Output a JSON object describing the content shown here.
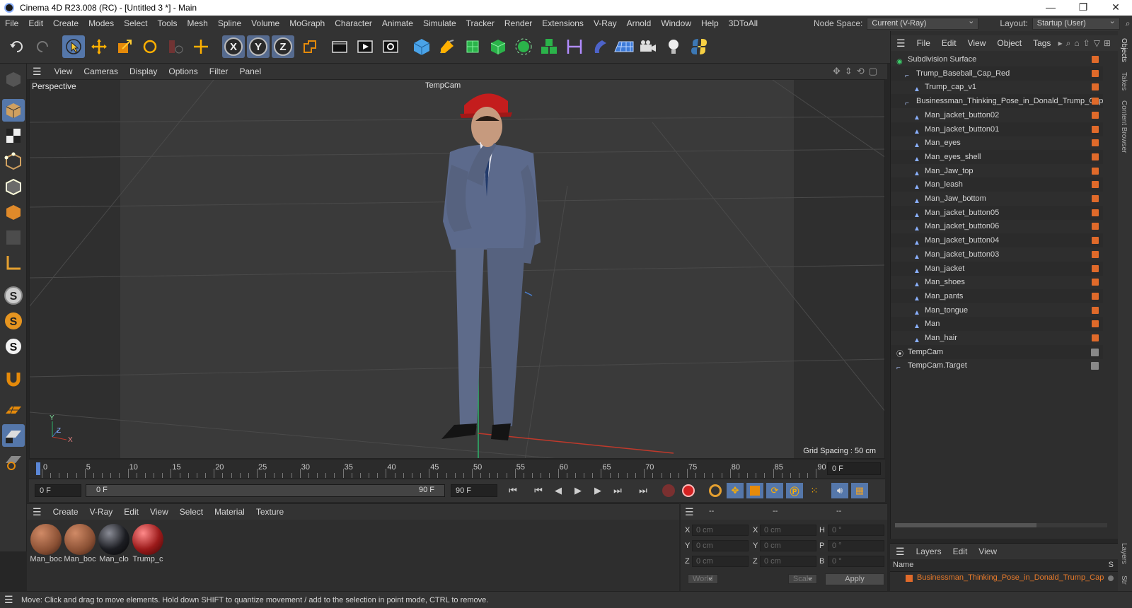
{
  "window": {
    "title": "Cinema 4D R23.008 (RC) - [Untitled 3 *] - Main",
    "controls": [
      "—",
      "❐",
      "✕"
    ]
  },
  "menubar": {
    "items": [
      "File",
      "Edit",
      "Create",
      "Modes",
      "Select",
      "Tools",
      "Mesh",
      "Spline",
      "Volume",
      "MoGraph",
      "Character",
      "Animate",
      "Simulate",
      "Tracker",
      "Render",
      "Extensions",
      "V-Ray",
      "Arnold",
      "Window",
      "Help",
      "3DToAll"
    ],
    "node_space_label": "Node Space:",
    "node_space_value": "Current (V-Ray)",
    "layout_label": "Layout:",
    "layout_value": "Startup (User)"
  },
  "toolbar": {
    "icons": [
      "undo-icon",
      "redo-icon",
      "select-arrow-icon",
      "move-icon",
      "scale-icon",
      "rotate-icon",
      "recent-tools-icon",
      "live-selection-icon",
      "x-axis-icon",
      "y-axis-icon",
      "z-axis-icon",
      "world-coordinate-icon",
      "render-region-icon",
      "render-view-icon",
      "render-settings-icon",
      "cube-icon",
      "pen-icon",
      "subdivision-icon",
      "extrude-icon",
      "mograph-cloner-icon",
      "array-icon",
      "deformer-icon",
      "floor-icon",
      "camera-icon",
      "light-icon",
      "python-icon"
    ],
    "axis_letters": [
      "X",
      "Y",
      "Z"
    ]
  },
  "viewport": {
    "menu": [
      "View",
      "Cameras",
      "Display",
      "Options",
      "Filter",
      "Panel"
    ],
    "view_name": "Perspective",
    "camera_label": "TempCam",
    "grid_spacing": "Grid Spacing : 50 cm",
    "axis": {
      "x": "X",
      "y": "Y",
      "z": "Z"
    }
  },
  "timeline": {
    "ticks": [
      "0",
      "5",
      "10",
      "15",
      "20",
      "25",
      "30",
      "35",
      "40",
      "45",
      "50",
      "55",
      "60",
      "65",
      "70",
      "75",
      "80",
      "85",
      "90"
    ],
    "current_frame": "0 F"
  },
  "transport": {
    "start_field": "0 F",
    "range_start": "0 F",
    "range_end": "90 F",
    "end_field": "90 F"
  },
  "materials": {
    "menu": [
      "Create",
      "V-Ray",
      "Edit",
      "View",
      "Select",
      "Material",
      "Texture"
    ],
    "items": [
      {
        "name": "Man_boc",
        "color": "#8a5034"
      },
      {
        "name": "Man_boc",
        "color": "#8a5034"
      },
      {
        "name": "Man_clo",
        "color": "#1c1d22"
      },
      {
        "name": "Trump_c",
        "color": "#9b1a1a"
      }
    ]
  },
  "coordinates": {
    "headers": [
      "--",
      "--",
      "--"
    ],
    "rows": [
      {
        "a": "X",
        "av": "0 cm",
        "b": "X",
        "bv": "0 cm",
        "c": "H",
        "cv": "0 °"
      },
      {
        "a": "Y",
        "av": "0 cm",
        "b": "Y",
        "bv": "0 cm",
        "c": "P",
        "cv": "0 °"
      },
      {
        "a": "Z",
        "av": "0 cm",
        "b": "Z",
        "bv": "0 cm",
        "c": "B",
        "cv": "0 °"
      }
    ],
    "mode1": "World",
    "mode2": "Scale",
    "apply": "Apply"
  },
  "objects": {
    "menu": [
      "File",
      "Edit",
      "View",
      "Object",
      "Tags"
    ],
    "tree": [
      {
        "name": "Subdivision Surface",
        "indent": 0,
        "type": "subd",
        "tag": "orange"
      },
      {
        "name": "Trump_Baseball_Cap_Red",
        "indent": 1,
        "type": "null",
        "tag": "orange"
      },
      {
        "name": "Trump_cap_v1",
        "indent": 2,
        "type": "poly",
        "tag": "orange"
      },
      {
        "name": "Businessman_Thinking_Pose_in_Donald_Trump_Cap",
        "indent": 1,
        "type": "null",
        "tag": "orange"
      },
      {
        "name": "Man_jacket_button02",
        "indent": 2,
        "type": "poly",
        "tag": "orange"
      },
      {
        "name": "Man_jacket_button01",
        "indent": 2,
        "type": "poly",
        "tag": "orange"
      },
      {
        "name": "Man_eyes",
        "indent": 2,
        "type": "poly",
        "tag": "orange"
      },
      {
        "name": "Man_eyes_shell",
        "indent": 2,
        "type": "poly",
        "tag": "orange"
      },
      {
        "name": "Man_Jaw_top",
        "indent": 2,
        "type": "poly",
        "tag": "orange"
      },
      {
        "name": "Man_leash",
        "indent": 2,
        "type": "poly",
        "tag": "orange"
      },
      {
        "name": "Man_Jaw_bottom",
        "indent": 2,
        "type": "poly",
        "tag": "orange"
      },
      {
        "name": "Man_jacket_button05",
        "indent": 2,
        "type": "poly",
        "tag": "orange"
      },
      {
        "name": "Man_jacket_button06",
        "indent": 2,
        "type": "poly",
        "tag": "orange"
      },
      {
        "name": "Man_jacket_button04",
        "indent": 2,
        "type": "poly",
        "tag": "orange"
      },
      {
        "name": "Man_jacket_button03",
        "indent": 2,
        "type": "poly",
        "tag": "orange"
      },
      {
        "name": "Man_jacket",
        "indent": 2,
        "type": "poly",
        "tag": "orange"
      },
      {
        "name": "Man_shoes",
        "indent": 2,
        "type": "poly",
        "tag": "orange"
      },
      {
        "name": "Man_pants",
        "indent": 2,
        "type": "poly",
        "tag": "orange"
      },
      {
        "name": "Man_tongue",
        "indent": 2,
        "type": "poly",
        "tag": "orange"
      },
      {
        "name": "Man",
        "indent": 2,
        "type": "poly",
        "tag": "orange"
      },
      {
        "name": "Man_hair",
        "indent": 2,
        "type": "poly",
        "tag": "orange"
      },
      {
        "name": "TempCam",
        "indent": 0,
        "type": "cam",
        "tag": "cam"
      },
      {
        "name": "TempCam.Target",
        "indent": 0,
        "type": "null",
        "tag": "cam"
      }
    ]
  },
  "side_tabs": [
    "Objects",
    "Takes",
    "Content Browser",
    "Layers",
    "Str"
  ],
  "layers": {
    "menu": [
      "Layers",
      "Edit",
      "View"
    ],
    "col_name": "Name",
    "col_s": "S",
    "item": "Businessman_Thinking_Pose_in_Donald_Trump_Cap"
  },
  "status": "Move: Click and drag to move elements. Hold down SHIFT to quantize movement / add to the selection in point mode, CTRL to remove.",
  "colors": {
    "accent": "#5577aa",
    "tag": "#e06a2a",
    "bg": "#333333"
  }
}
